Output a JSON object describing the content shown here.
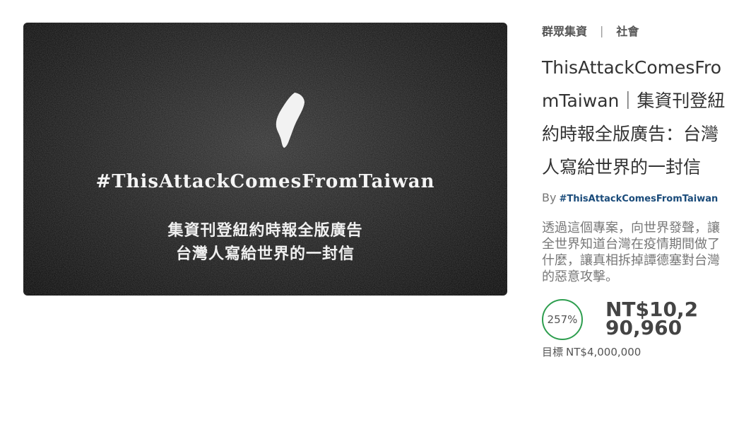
{
  "hero": {
    "hashtag": "#ThisAttackComesFromTaiwan",
    "line1": "集資刊登紐約時報全版廣告",
    "line2": "台灣人寫給世界的一封信"
  },
  "breadcrumb": {
    "category": "群眾集資",
    "separator": "|",
    "subcategory": "社會"
  },
  "project": {
    "title": "ThisAttackComesFromTaiwan｜集資刊登紐約時報全版廣告：台灣人寫給世界的一封信",
    "by_label": "By",
    "author": "#ThisAttackComesFromTaiwan",
    "description": "透過這個專案，向世界發聲，讓全世界知道台灣在疫情期間做了什麼，讓真相拆掉譚德塞對台灣的惡意攻擊。"
  },
  "funding": {
    "percent": "257%",
    "raised": "NT$10,290,960",
    "goal_label": "目標",
    "goal_value": "NT$4,000,000",
    "ring_color": "#2e9e4f"
  }
}
